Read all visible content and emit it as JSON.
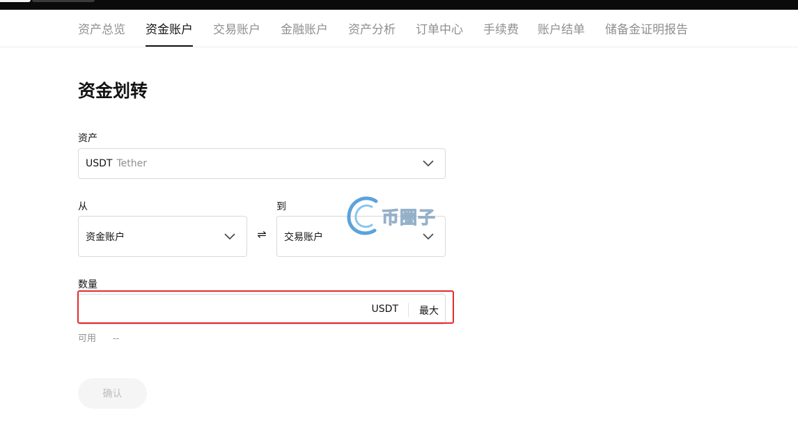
{
  "nav": {
    "tabs": [
      {
        "label": "资产总览",
        "active": false
      },
      {
        "label": "资金账户",
        "active": true
      },
      {
        "label": "交易账户",
        "active": false
      },
      {
        "label": "金融账户",
        "active": false
      },
      {
        "label": "资产分析",
        "active": false
      },
      {
        "label": "订单中心",
        "active": false
      },
      {
        "label": "手续费",
        "active": false
      },
      {
        "label": "账户结单",
        "active": false
      },
      {
        "label": "储备金证明报告",
        "active": false
      }
    ]
  },
  "page": {
    "title": "资金划转"
  },
  "form": {
    "asset_label": "资产",
    "asset_value": "USDT",
    "asset_name": "Tether",
    "from_label": "从",
    "from_value": "资金账户",
    "to_label": "到",
    "to_value": "交易账户",
    "swap_glyph": "⇌",
    "amount_label": "数量",
    "amount_value": "",
    "amount_unit": "USDT",
    "max_label": "最大",
    "available_label": "可用",
    "available_value": "--",
    "confirm_label": "确认"
  },
  "watermark": {
    "text": "币圈子"
  },
  "colors": {
    "active_text": "#121212",
    "muted_text": "#8f8f8f",
    "highlight_border": "#e32b2b",
    "disabled_button_bg": "#f5f5f5"
  }
}
